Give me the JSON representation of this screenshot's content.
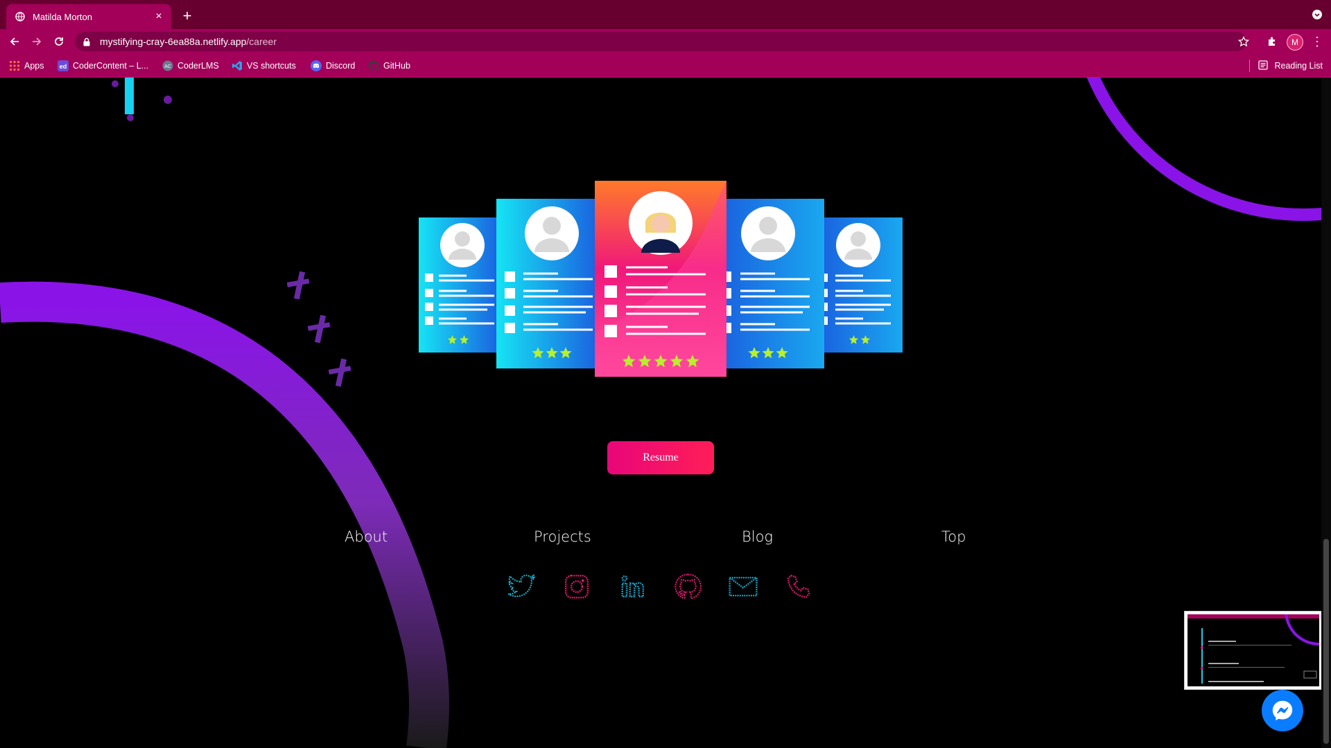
{
  "browser": {
    "tab_title": "Matilda Morton",
    "url_host": "mystifying-cray-6ea88a.netlify.app",
    "url_path": "/career",
    "profile_initial": "M",
    "bookmarks": [
      "Apps",
      "CoderContent – L...",
      "CoderLMS",
      "VS shortcuts",
      "Discord",
      "GitHub"
    ],
    "reading_list": "Reading List"
  },
  "page": {
    "resume_button": "Resume",
    "footer_nav": [
      "About",
      "Projects",
      "Blog",
      "Top"
    ],
    "social_icons": [
      "twitter-icon",
      "instagram-icon",
      "linkedin-icon",
      "github-icon",
      "email-icon",
      "phone-icon"
    ],
    "resume_cards": [
      {
        "stars": 2
      },
      {
        "stars": 3
      },
      {
        "stars": 5
      },
      {
        "stars": 3
      },
      {
        "stars": 2
      }
    ]
  },
  "colors": {
    "chrome_dark": "#67002f",
    "chrome": "#a3005a",
    "accent_pink": "#e8067a",
    "purple_ring": "#8a14e8",
    "card_blue": "#1a88e8",
    "card_pink": "#f0187a"
  }
}
